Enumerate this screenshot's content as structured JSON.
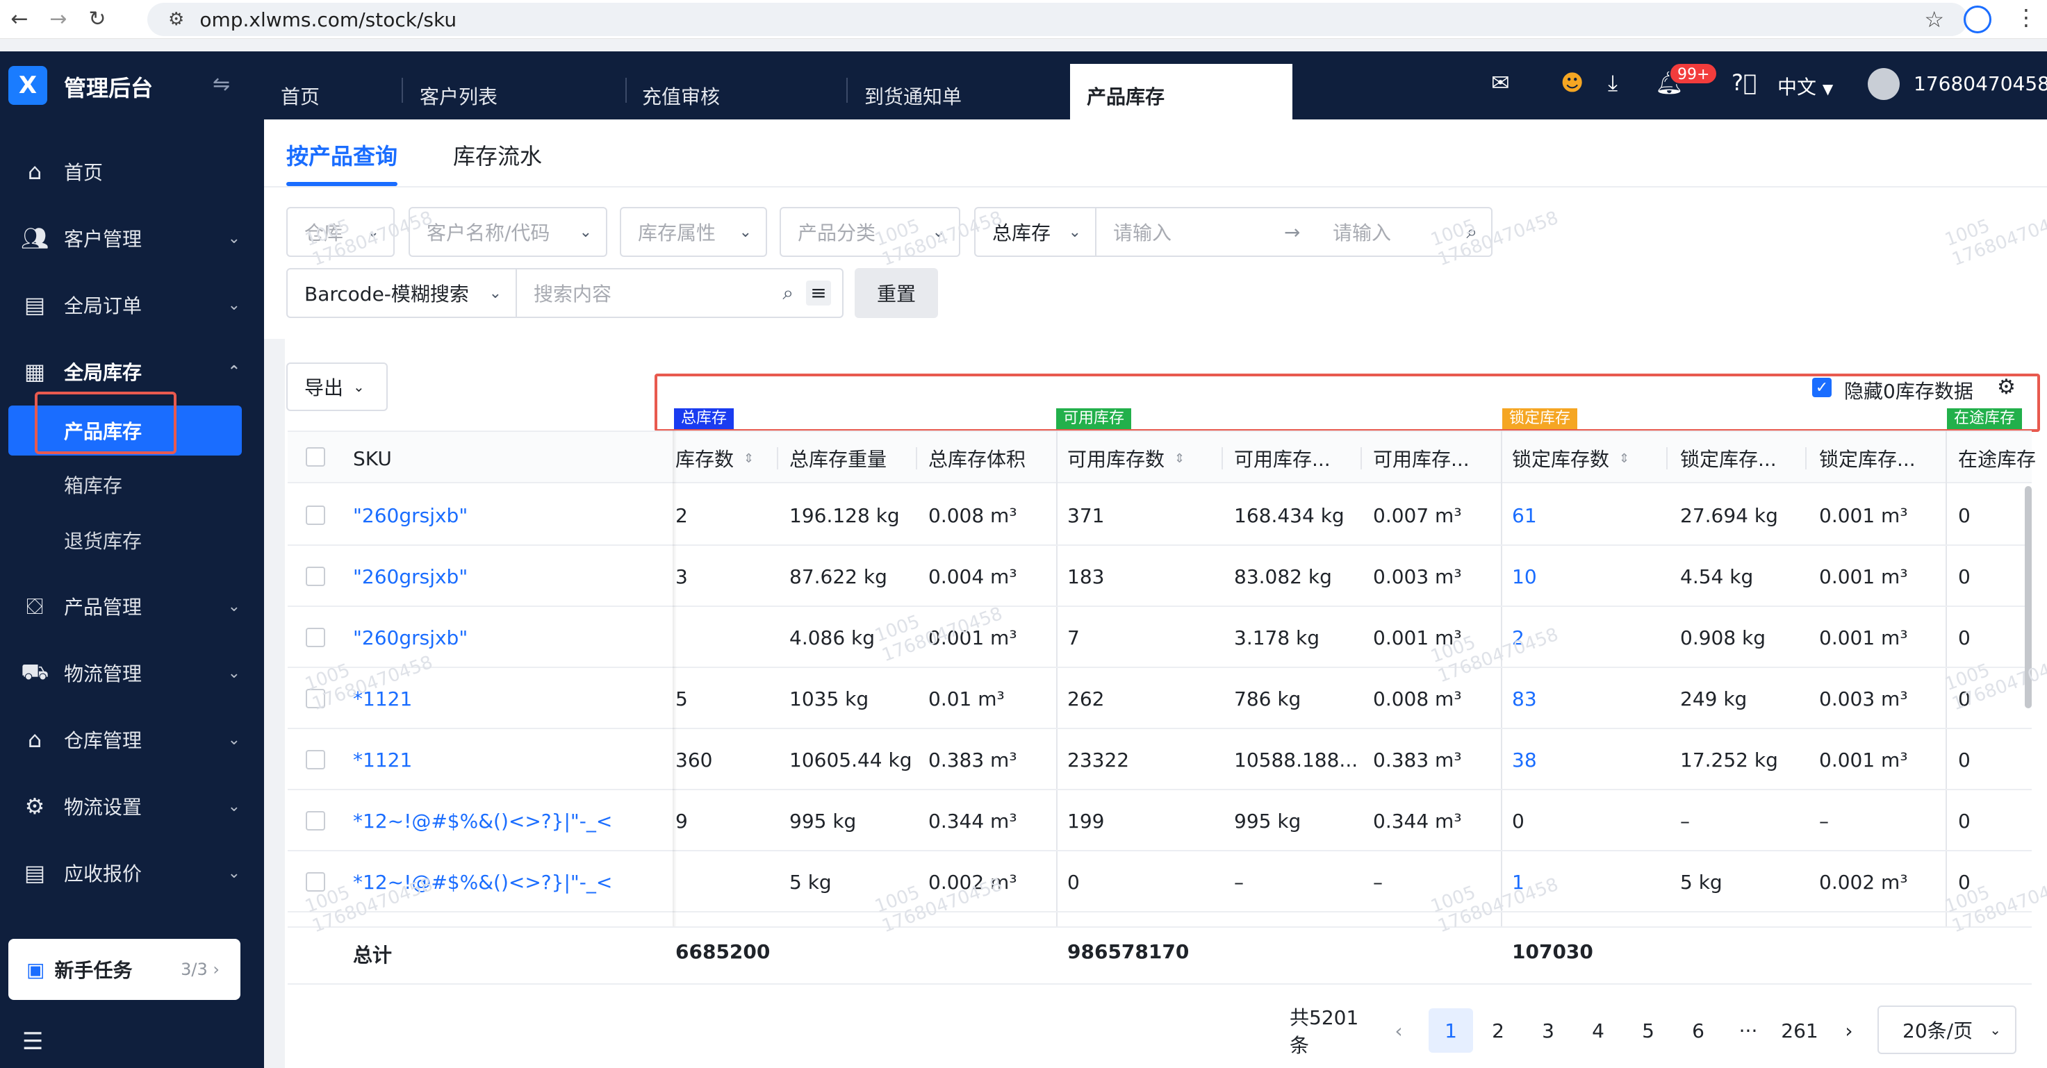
{
  "browser": {
    "url": "omp.xlwms.com/stock/sku"
  },
  "app": {
    "logo_letter": "X",
    "title": "管理后台"
  },
  "header_tabs": [
    {
      "label": "首页"
    },
    {
      "label": "客户列表"
    },
    {
      "label": "充值审核"
    },
    {
      "label": "到货通知单"
    },
    {
      "label": "产品库存"
    }
  ],
  "header": {
    "badge": "99+",
    "language": "中文",
    "user": "17680470458"
  },
  "sidebar": {
    "items": [
      {
        "label": "首页",
        "icon": "home-icon"
      },
      {
        "label": "客户管理",
        "icon": "users-icon"
      },
      {
        "label": "全局订单",
        "icon": "order-icon"
      },
      {
        "label": "全局库存",
        "icon": "warehouse-icon"
      },
      {
        "label": "产品管理",
        "icon": "product-icon"
      },
      {
        "label": "物流管理",
        "icon": "truck-icon"
      },
      {
        "label": "仓库管理",
        "icon": "storehouse-icon"
      },
      {
        "label": "物流设置",
        "icon": "logistics-setting-icon"
      },
      {
        "label": "应收报价",
        "icon": "quote-icon"
      }
    ],
    "sub_items": [
      {
        "label": "产品库存"
      },
      {
        "label": "箱库存"
      },
      {
        "label": "退货库存"
      }
    ],
    "task": {
      "label": "新手任务",
      "count": "3/3"
    }
  },
  "content_tabs": [
    {
      "label": "按产品查询"
    },
    {
      "label": "库存流水"
    }
  ],
  "filters": {
    "warehouse": "仓库",
    "customer": "客户名称/代码",
    "attribute": "库存属性",
    "category": "产品分类",
    "stock_type": "总库存",
    "range_from": "请输入",
    "range_to": "请输入",
    "search_type": "Barcode-模糊搜索",
    "search_placeholder": "搜索内容",
    "reset": "重置"
  },
  "toolbar": {
    "export": "导出",
    "hide_zero": "隐藏0库存数据"
  },
  "groups": {
    "total": "总库存",
    "available": "可用库存",
    "locked": "锁定库存",
    "transit": "在途库存"
  },
  "colors": {
    "total": "#1a3cf0",
    "available": "#22b04b",
    "locked": "#f5a623",
    "transit": "#22b04b"
  },
  "columns": {
    "sku": "SKU",
    "total_qty": "库存数",
    "total_weight": "总库存重量",
    "total_volume": "总库存体积",
    "avail_qty": "可用库存数",
    "avail_weight": "可用库存...",
    "avail_volume": "可用库存...",
    "locked_qty": "锁定库存数",
    "locked_weight": "锁定库存...",
    "locked_volume": "锁定库存...",
    "transit": "在途库存"
  },
  "rows": [
    {
      "sku": "\"260grsjxb\"",
      "tq": "2",
      "tw": "196.128 kg",
      "tv": "0.008 m³",
      "aq": "371",
      "aw": "168.434 kg",
      "av": "0.007 m³",
      "lq": "61",
      "lw": "27.694 kg",
      "lv": "0.001 m³",
      "tr": "0"
    },
    {
      "sku": "\"260grsjxb\"",
      "tq": "3",
      "tw": "87.622 kg",
      "tv": "0.004 m³",
      "aq": "183",
      "aw": "83.082 kg",
      "av": "0.003 m³",
      "lq": "10",
      "lw": "4.54 kg",
      "lv": "0.001 m³",
      "tr": "0"
    },
    {
      "sku": "\"260grsjxb\"",
      "tq": "",
      "tw": "4.086 kg",
      "tv": "0.001 m³",
      "aq": "7",
      "aw": "3.178 kg",
      "av": "0.001 m³",
      "lq": "2",
      "lw": "0.908 kg",
      "lv": "0.001 m³",
      "tr": "0"
    },
    {
      "sku": "*1121",
      "tq": "5",
      "tw": "1035 kg",
      "tv": "0.01 m³",
      "aq": "262",
      "aw": "786 kg",
      "av": "0.008 m³",
      "lq": "83",
      "lw": "249 kg",
      "lv": "0.003 m³",
      "tr": "0"
    },
    {
      "sku": "*1121",
      "tq": "360",
      "tw": "10605.44 kg",
      "tv": "0.383 m³",
      "aq": "23322",
      "aw": "10588.188...",
      "av": "0.383 m³",
      "lq": "38",
      "lw": "17.252 kg",
      "lv": "0.001 m³",
      "tr": "0"
    },
    {
      "sku": "*12~!@#$%&()<>?}|\"-_<",
      "tq": "9",
      "tw": "995 kg",
      "tv": "0.344 m³",
      "aq": "199",
      "aw": "995 kg",
      "av": "0.344 m³",
      "lq": "0",
      "lw": "–",
      "lv": "–",
      "tr": "0"
    },
    {
      "sku": "*12~!@#$%&()<>?}|\"-_<",
      "tq": "",
      "tw": "5 kg",
      "tv": "0.002 m³",
      "aq": "0",
      "aw": "–",
      "av": "–",
      "lq": "1",
      "lw": "5 kg",
      "lv": "0.002 m³",
      "tr": "0"
    }
  ],
  "totals": {
    "label": "总计",
    "total": "6685200",
    "available": "986578170",
    "locked": "107030"
  },
  "pagination": {
    "summary": "共5201条",
    "pages": [
      "1",
      "2",
      "3",
      "4",
      "5",
      "6"
    ],
    "ellipsis": "···",
    "last": "261",
    "size": "20条/页"
  },
  "watermark": {
    "line1": "1005",
    "line2": "17680470458"
  }
}
